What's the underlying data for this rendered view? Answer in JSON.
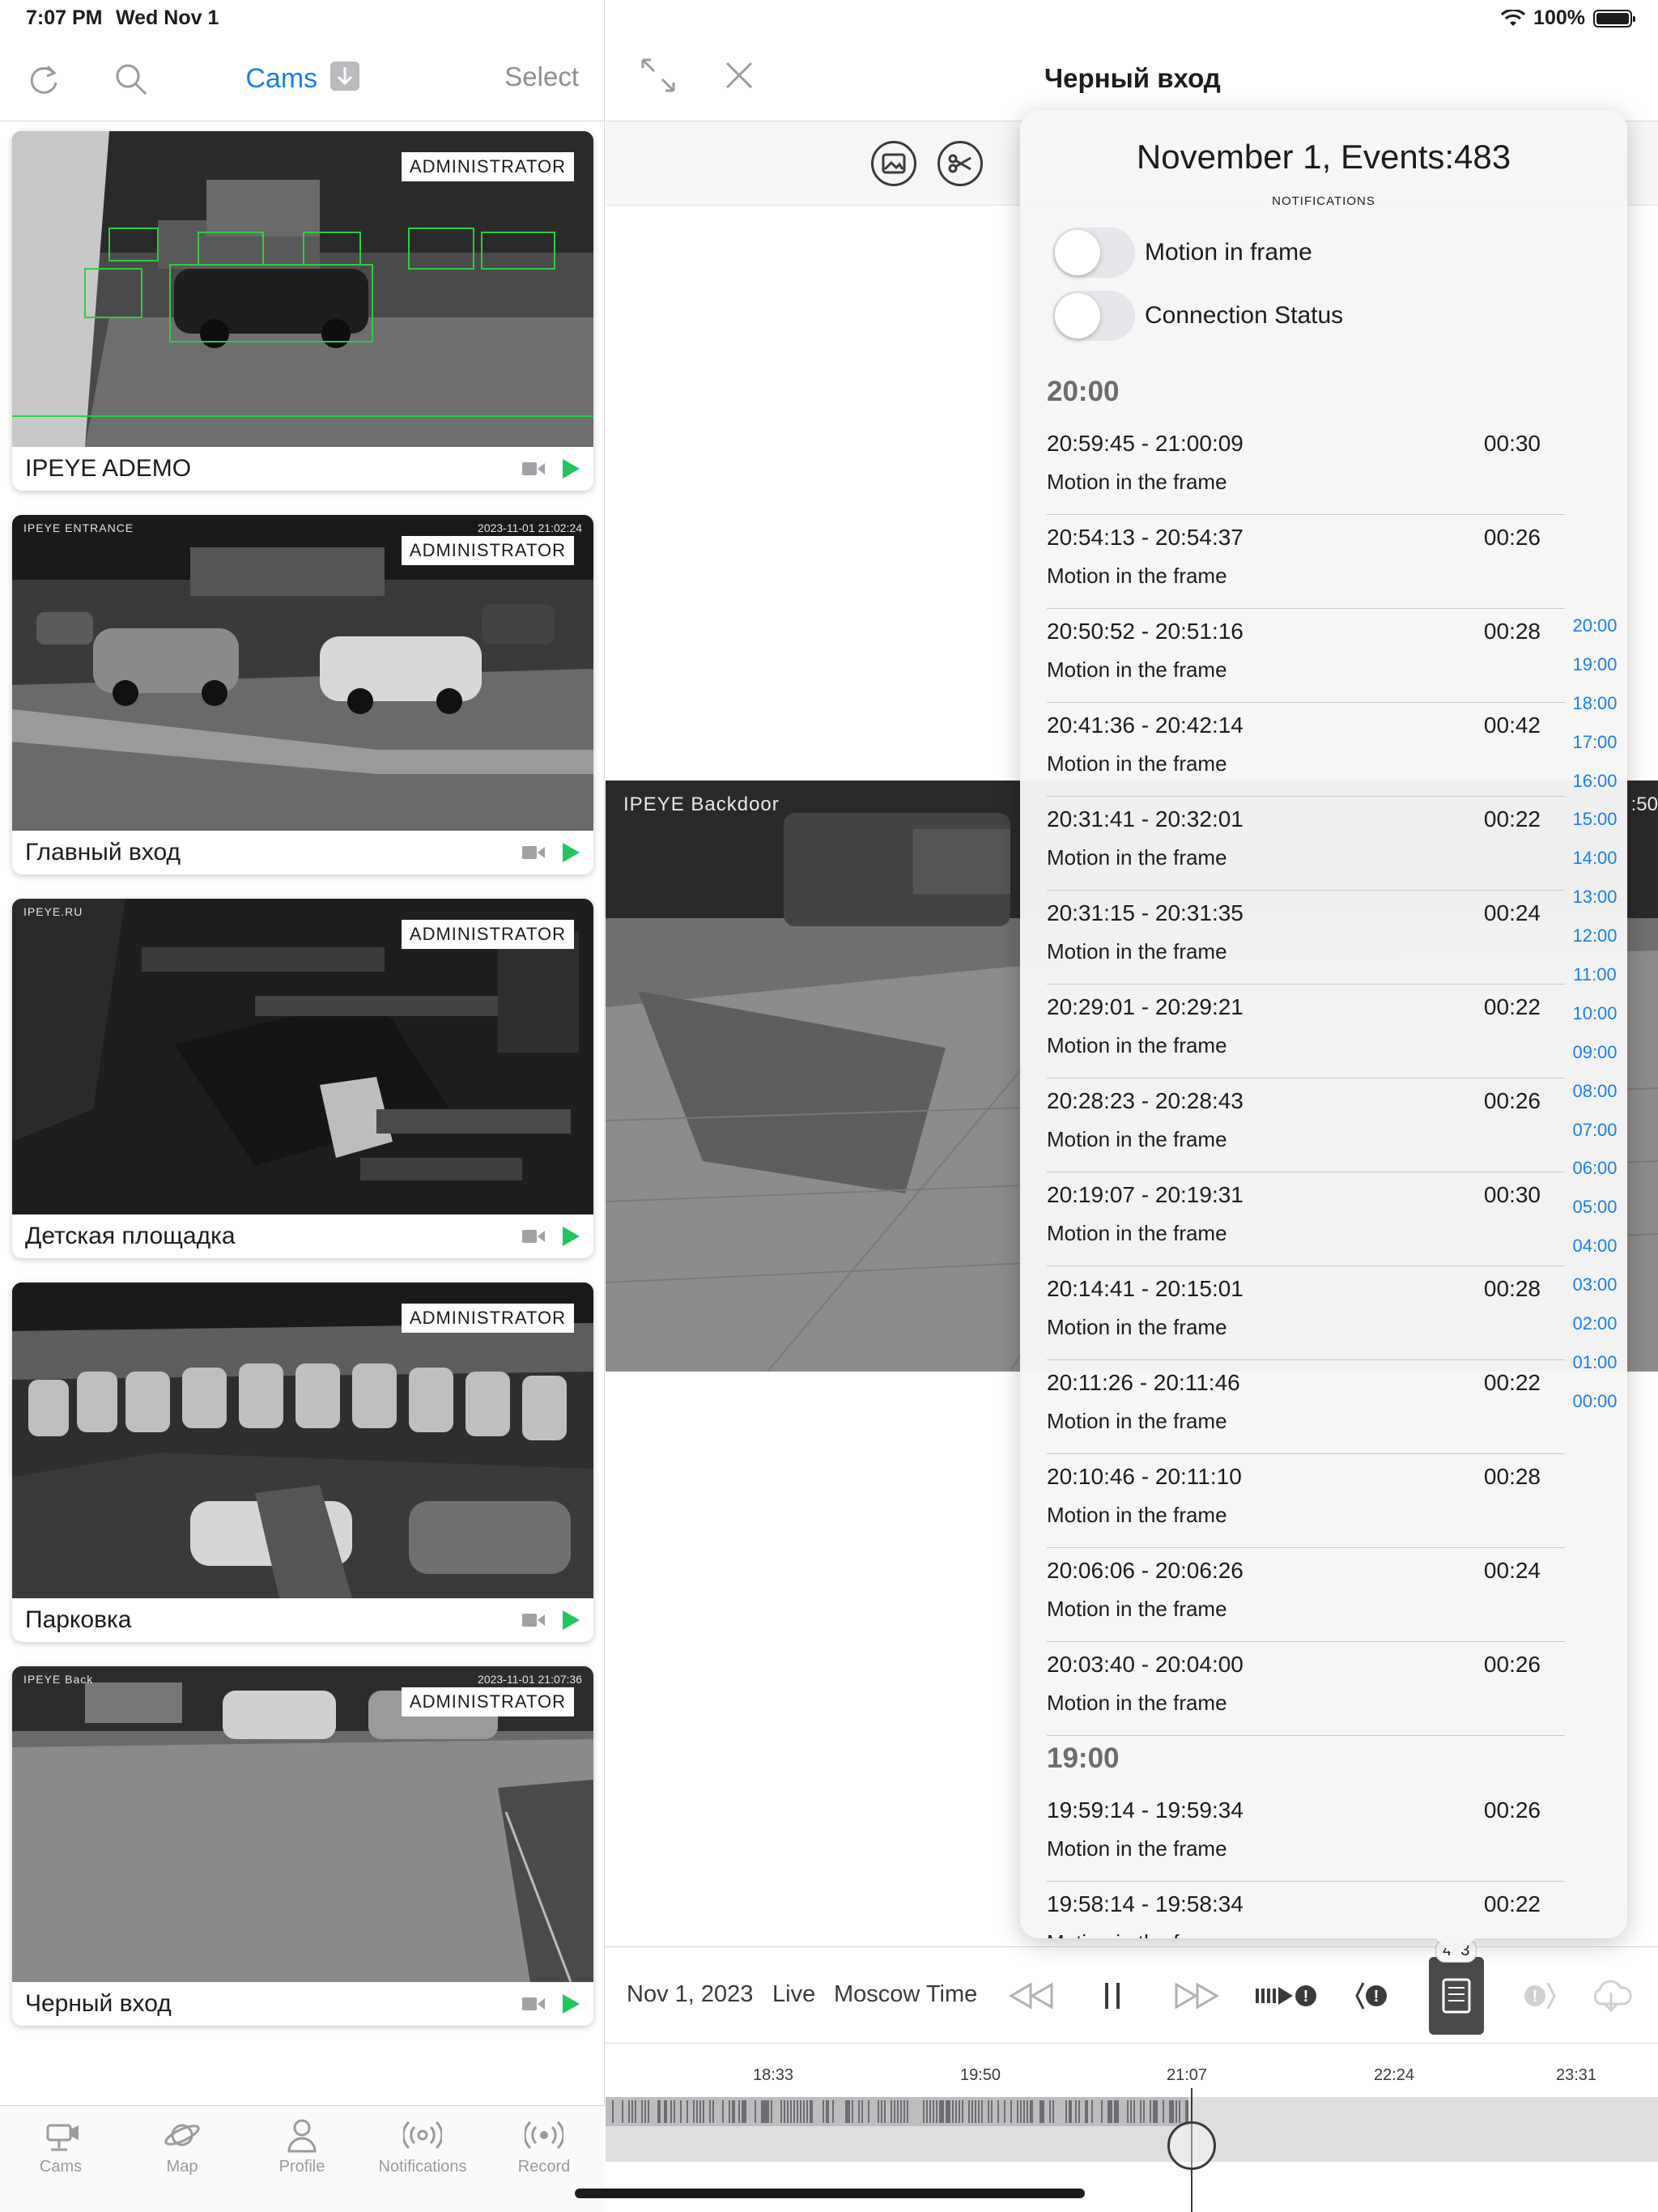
{
  "status": {
    "time": "7:07 PM",
    "date": "Wed Nov 1",
    "battery": "100%"
  },
  "sidebar": {
    "title": "Cams",
    "select_label": "Select",
    "cameras": [
      {
        "name": "IPEYE ADEMO",
        "badge": "ADMINISTRATOR",
        "overlay_left": "",
        "overlay_right": ""
      },
      {
        "name": "Главный вход",
        "badge": "ADMINISTRATOR",
        "overlay_left": "IPEYE ENTRANCE",
        "overlay_right": "2023-11-01  21:02:24"
      },
      {
        "name": "Детская площадка",
        "badge": "ADMINISTRATOR",
        "overlay_left": "IPEYE.RU",
        "overlay_right": ""
      },
      {
        "name": "Парковка",
        "badge": "ADMINISTRATOR",
        "overlay_left": "",
        "overlay_right": ""
      },
      {
        "name": "Черный вход",
        "badge": "ADMINISTRATOR",
        "overlay_left": "IPEYE Back",
        "overlay_right": "2023-11-01  21:07:36"
      }
    ],
    "tabs": [
      {
        "label": "Cams",
        "icon": "camera-icon"
      },
      {
        "label": "Map",
        "icon": "planet-icon"
      },
      {
        "label": "Profile",
        "icon": "person-icon"
      },
      {
        "label": "Notifications",
        "icon": "broadcast-icon"
      },
      {
        "label": "Record",
        "icon": "record-icon"
      }
    ]
  },
  "main": {
    "title": "Черный вход",
    "video_label": "IPEYE  Backdoor",
    "video_timestamp": ":50"
  },
  "events": {
    "title": "November 1, Events:483",
    "subtitle": "NOTIFICATIONS",
    "toggles": [
      {
        "label": "Motion in frame",
        "on": false
      },
      {
        "label": "Connection Status",
        "on": false
      }
    ],
    "groups": [
      {
        "hour": "20:00",
        "items": [
          {
            "range": "20:59:45 - 21:00:09",
            "duration": "00:30",
            "type": "Motion in the frame"
          },
          {
            "range": "20:54:13 - 20:54:37",
            "duration": "00:26",
            "type": "Motion in the frame"
          },
          {
            "range": "20:50:52 - 20:51:16",
            "duration": "00:28",
            "type": "Motion in the frame"
          },
          {
            "range": "20:41:36 - 20:42:14",
            "duration": "00:42",
            "type": "Motion in the frame"
          },
          {
            "range": "20:31:41 - 20:32:01",
            "duration": "00:22",
            "type": "Motion in the frame"
          },
          {
            "range": "20:31:15 - 20:31:35",
            "duration": "00:24",
            "type": "Motion in the frame"
          },
          {
            "range": "20:29:01 - 20:29:21",
            "duration": "00:22",
            "type": "Motion in the frame"
          },
          {
            "range": "20:28:23 - 20:28:43",
            "duration": "00:26",
            "type": "Motion in the frame"
          },
          {
            "range": "20:19:07 - 20:19:31",
            "duration": "00:30",
            "type": "Motion in the frame"
          },
          {
            "range": "20:14:41 - 20:15:01",
            "duration": "00:28",
            "type": "Motion in the frame"
          },
          {
            "range": "20:11:26 - 20:11:46",
            "duration": "00:22",
            "type": "Motion in the frame"
          },
          {
            "range": "20:10:46 - 20:11:10",
            "duration": "00:28",
            "type": "Motion in the frame"
          },
          {
            "range": "20:06:06 - 20:06:26",
            "duration": "00:24",
            "type": "Motion in the frame"
          },
          {
            "range": "20:03:40 - 20:04:00",
            "duration": "00:26",
            "type": "Motion in the frame"
          }
        ]
      },
      {
        "hour": "19:00",
        "items": [
          {
            "range": "19:59:14 - 19:59:34",
            "duration": "00:26",
            "type": "Motion in the frame"
          },
          {
            "range": "19:58:14 - 19:58:34",
            "duration": "00:22",
            "type": "Motion in the frame"
          }
        ]
      }
    ],
    "hour_index": [
      "20:00",
      "19:00",
      "18:00",
      "17:00",
      "16:00",
      "15:00",
      "14:00",
      "13:00",
      "12:00",
      "11:00",
      "10:00",
      "09:00",
      "08:00",
      "07:00",
      "06:00",
      "05:00",
      "04:00",
      "03:00",
      "02:00",
      "01:00",
      "00:00"
    ]
  },
  "playback": {
    "date": "Nov 1, 2023",
    "mode": "Live",
    "timezone": "Moscow Time",
    "events_count": "483",
    "timeline_labels": [
      "18:33",
      "19:50",
      "21:07",
      "22:24",
      "23:31"
    ]
  },
  "colors": {
    "accent": "#1a7fe8",
    "play_green": "#22c55e",
    "muted": "#8e8e93"
  }
}
